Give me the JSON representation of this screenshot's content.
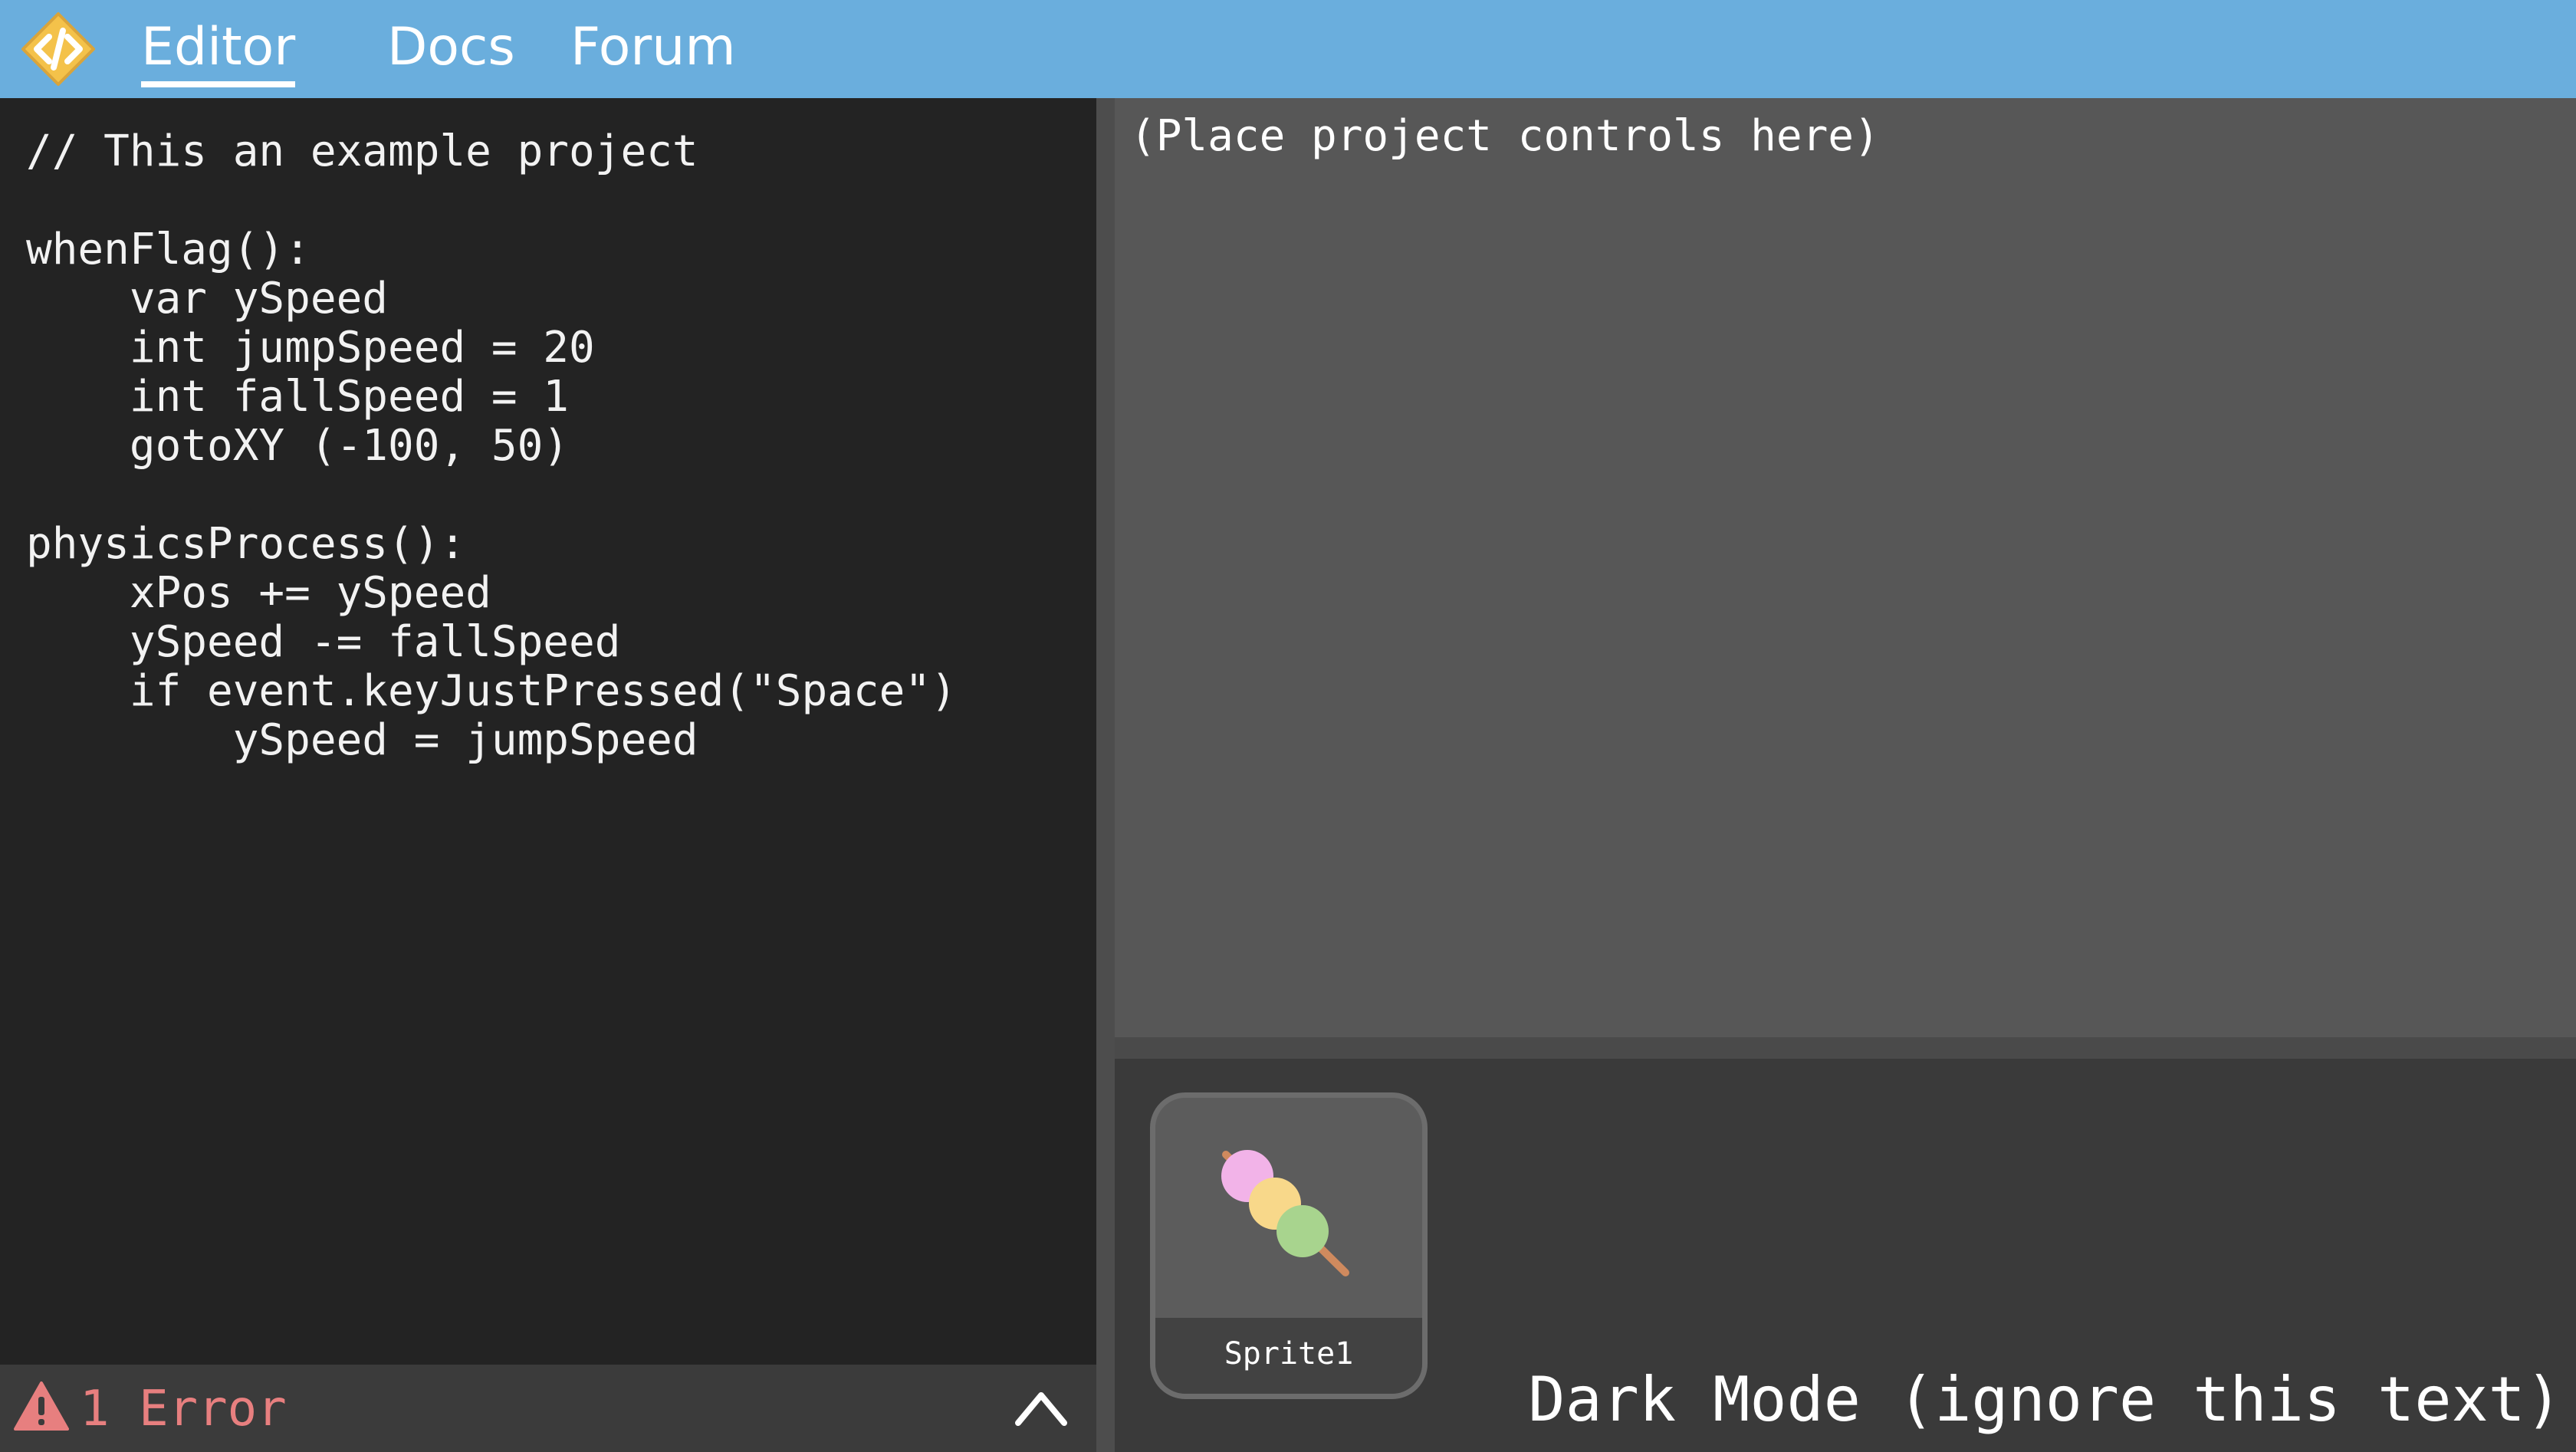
{
  "nav": {
    "logo_icon": "code-brackets-icon",
    "items": [
      {
        "label": "Editor",
        "active": true
      },
      {
        "label": "Docs",
        "active": false
      },
      {
        "label": "Forum",
        "active": false
      }
    ]
  },
  "editor": {
    "code": "// This an example project\n\nwhenFlag():\n    var ySpeed\n    int jumpSpeed = 20\n    int fallSpeed = 1\n    gotoXY (-100, 50)\n\nphysicsProcess():\n    xPos += ySpeed\n    ySpeed -= fallSpeed\n    if event.keyJustPressed(\"Space\")\n        ySpeed = jumpSpeed",
    "error_label": "1 Error",
    "error_icon": "warning-icon",
    "expand_icon": "chevron-up-icon"
  },
  "stage": {
    "placeholder": "(Place project controls here)"
  },
  "sprites": {
    "items": [
      {
        "name": "Sprite1",
        "icon": "dango-skewer-icon"
      }
    ]
  },
  "note": "Dark Mode (ignore this text)",
  "colors": {
    "accent": "#6aaedd",
    "logo": "#f4c24a",
    "editor_bg": "#232323",
    "stage_bg": "#575757",
    "sprite_panel_bg": "#3a3a3a",
    "error": "#e77f7f"
  }
}
